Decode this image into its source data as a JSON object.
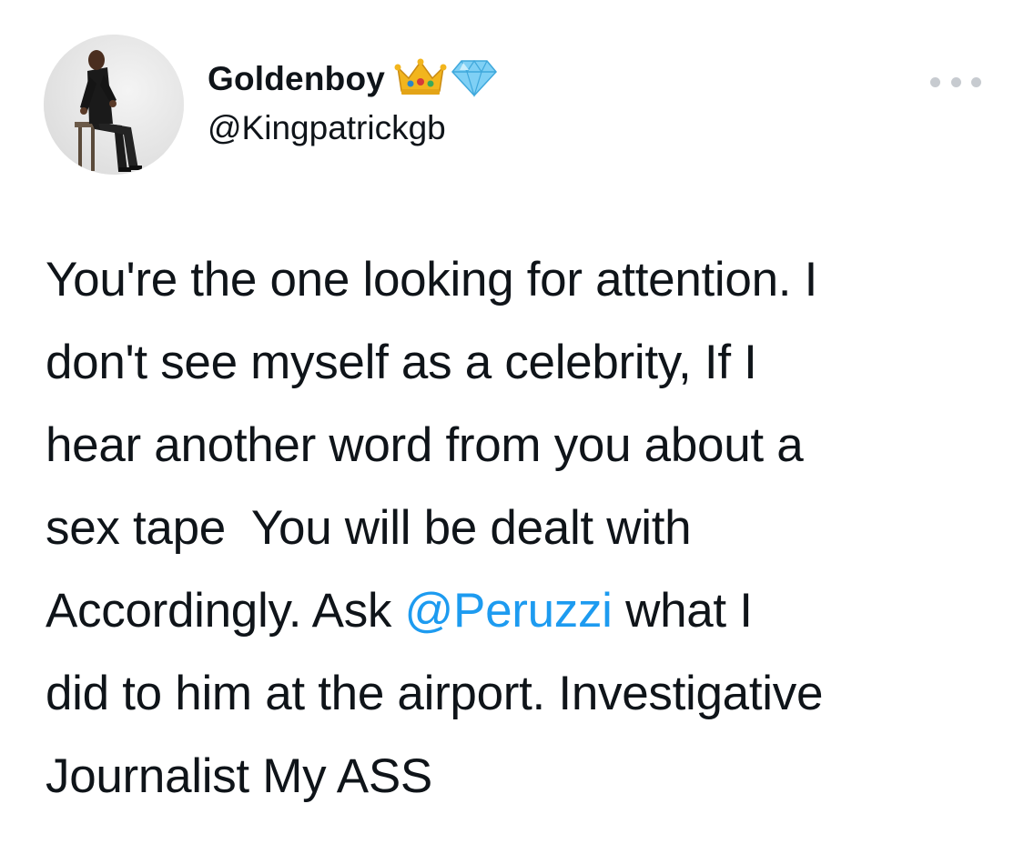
{
  "author": {
    "display_name": "Goldenboy",
    "handle": "@Kingpatrickgb",
    "badges": [
      "crown-emoji",
      "gem-emoji"
    ],
    "avatar": "avatar-photo"
  },
  "menu": {
    "icon": "more-options-icon"
  },
  "tweet": {
    "lines": [
      "You're the one looking for attention. I",
      "don't see myself as a celebrity, If I",
      "hear another word from you about a",
      "sex tape  You will be dealt with",
      "Accordingly. Ask ",
      "@Peruzzi",
      " what I",
      "did to him at the airport. Investigative",
      "Journalist My ASS"
    ]
  },
  "colors": {
    "mention": "#1d9bf0",
    "text": "#0f1419",
    "more_dots": "#c7cbd0"
  }
}
